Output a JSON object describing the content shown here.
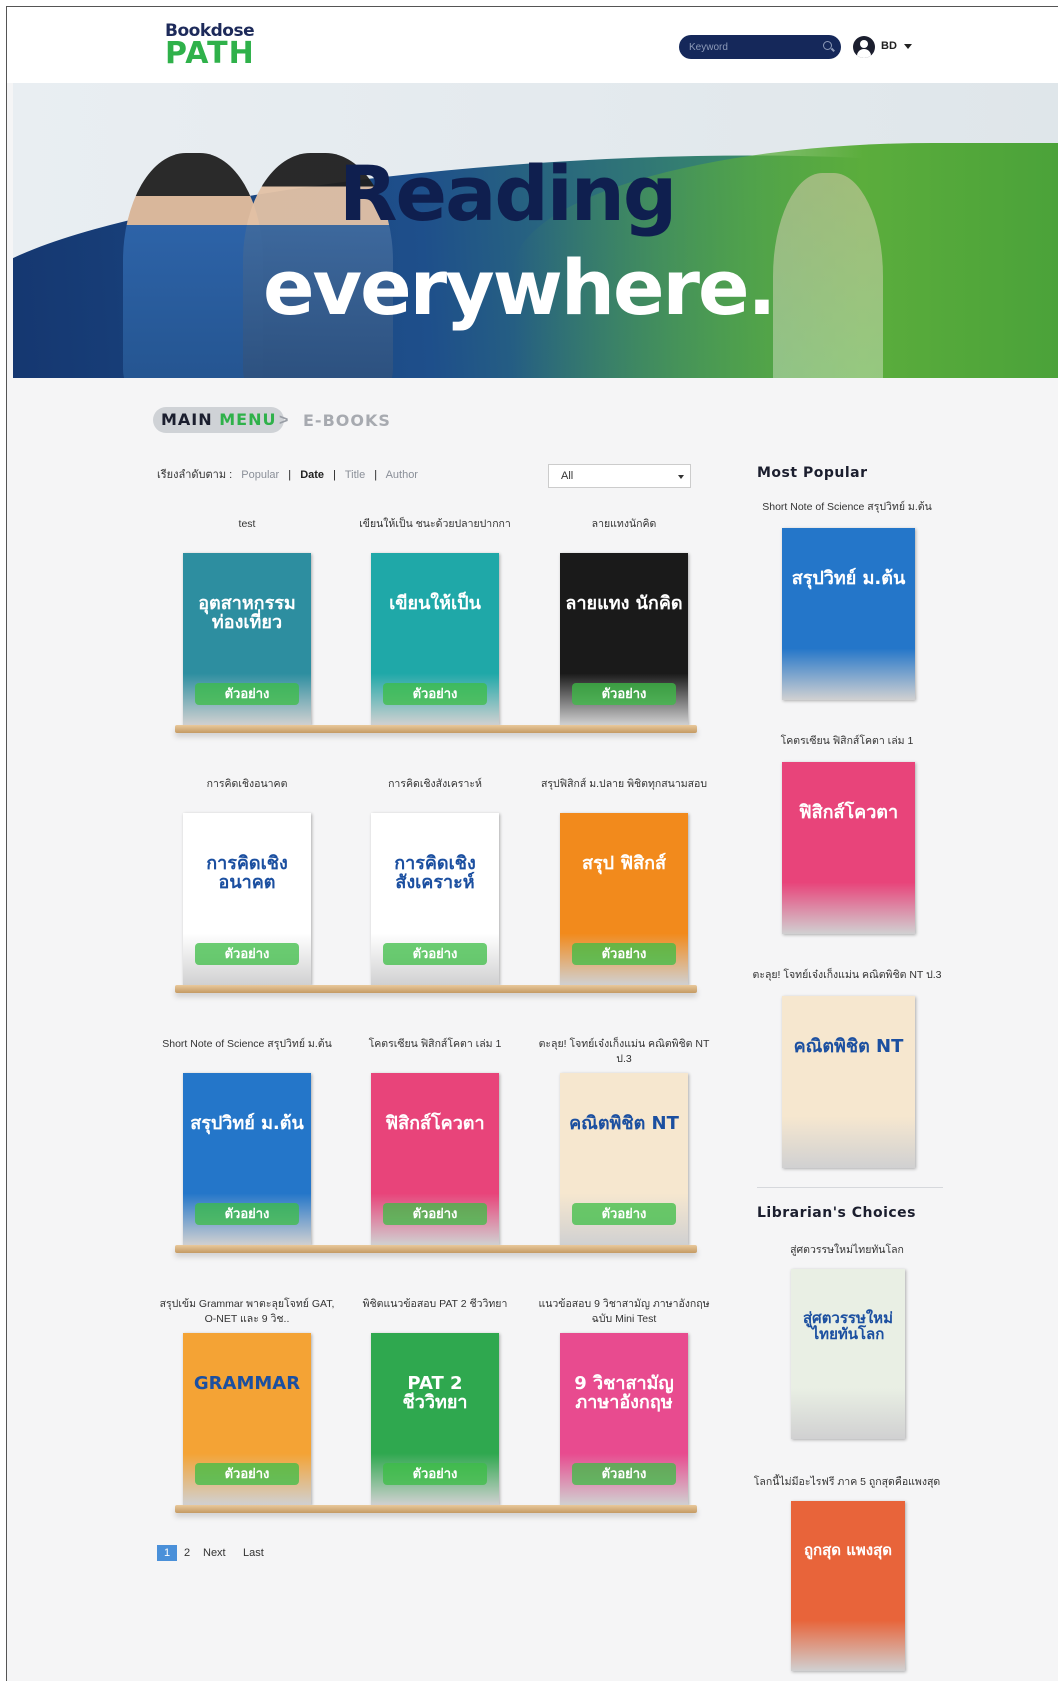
{
  "header": {
    "logo_top": "Bookdose",
    "logo_bottom": "PATH",
    "search_placeholder": "Keyword",
    "user_name": "BD"
  },
  "banner": {
    "line1": "Reading",
    "line2": "everywhere."
  },
  "breadcrumb": {
    "main_word1": "MAIN",
    "main_word2": "MENU",
    "separator": ">",
    "current": "E-BOOKS"
  },
  "sort": {
    "label": "เรียงลำดับตาม :",
    "options": [
      "Popular",
      "Date",
      "Title",
      "Author"
    ],
    "active": "Date",
    "filter_value": "All"
  },
  "sample_label": "ตัวอย่าง",
  "books": [
    {
      "title": "test",
      "cover_text": "อุตสาหกรรมท่องเที่ยว",
      "cover_color": "#2d8ea0"
    },
    {
      "title": "เขียนให้เป็น ชนะด้วยปลายปากกา",
      "cover_text": "เขียนให้เป็น",
      "cover_color": "#1fa8a8"
    },
    {
      "title": "ลายแทงนักคิด",
      "cover_text": "ลายแทง นักคิด",
      "cover_color": "#1a1a1a"
    },
    {
      "title": "การคิดเชิงอนาคต",
      "cover_text": "การคิดเชิง อนาคต",
      "cover_color": "#ffffff"
    },
    {
      "title": "การคิดเชิงสังเคราะห์",
      "cover_text": "การคิดเชิง สังเคราะห์",
      "cover_color": "#ffffff"
    },
    {
      "title": "สรุปฟิสิกส์ ม.ปลาย พิชิตทุกสนามสอบ",
      "cover_text": "สรุป ฟิสิกส์",
      "cover_color": "#f28a1c"
    },
    {
      "title": "Short Note of Science สรุปวิทย์ ม.ต้น",
      "cover_text": "สรุปวิทย์ ม.ต้น",
      "cover_color": "#2476c9"
    },
    {
      "title": "โคตรเซียน ฟิสิกส์โคตา เล่ม 1",
      "cover_text": "ฟิสิกส์โควตา",
      "cover_color": "#e8447a"
    },
    {
      "title": "ตะลุย! โจทย์เจ๋งเก็งแม่น คณิตพิชิต NT ป.3",
      "cover_text": "คณิตพิชิต NT",
      "cover_color": "#f6e7cf"
    },
    {
      "title": "สรุปเข้ม Grammar พาตะลุยโจทย์ GAT, O-NET และ 9 วิช..",
      "cover_text": "GRAMMAR",
      "cover_color": "#f4a335"
    },
    {
      "title": "พิชิตแนวข้อสอบ PAT 2 ชีววิทยา",
      "cover_text": "PAT 2 ชีววิทยา",
      "cover_color": "#2fa84f"
    },
    {
      "title": "แนวข้อสอบ 9 วิชาสามัญ ภาษาอังกฤษ ฉบับ Mini Test",
      "cover_text": "9 วิชาสามัญ ภาษาอังกฤษ",
      "cover_color": "#e84b8f"
    }
  ],
  "pagination": {
    "current": "1",
    "next_page": "2",
    "next_label": "Next",
    "last_label": "Last"
  },
  "sidebar": {
    "most_popular_heading": "Most Popular",
    "most_popular": [
      {
        "title": "Short Note of Science สรุปวิทย์ ม.ต้น",
        "cover_text": "สรุปวิทย์ ม.ต้น",
        "cover_color": "#2476c9"
      },
      {
        "title": "โคตรเซียน ฟิสิกส์โคตา เล่ม 1",
        "cover_text": "ฟิสิกส์โควตา",
        "cover_color": "#e8447a"
      },
      {
        "title": "ตะลุย! โจทย์เจ๋งเก็งแม่น คณิตพิชิต NT ป.3",
        "cover_text": "คณิตพิชิต NT",
        "cover_color": "#f6e7cf"
      }
    ],
    "librarian_heading": "Librarian's Choices",
    "librarian": [
      {
        "title": "สู่ศตวรรษใหม่ไทยทันโลก",
        "cover_text": "สู่ศตวรรษใหม่ ไทยทันโลก",
        "cover_color": "#e9efe4"
      },
      {
        "title": "โลกนี้ไม่มีอะไรฟรี ภาค 5 ถูกสุดคือแพงสุด",
        "cover_text": "ถูกสุด แพงสุด",
        "cover_color": "#e8643a"
      }
    ]
  }
}
